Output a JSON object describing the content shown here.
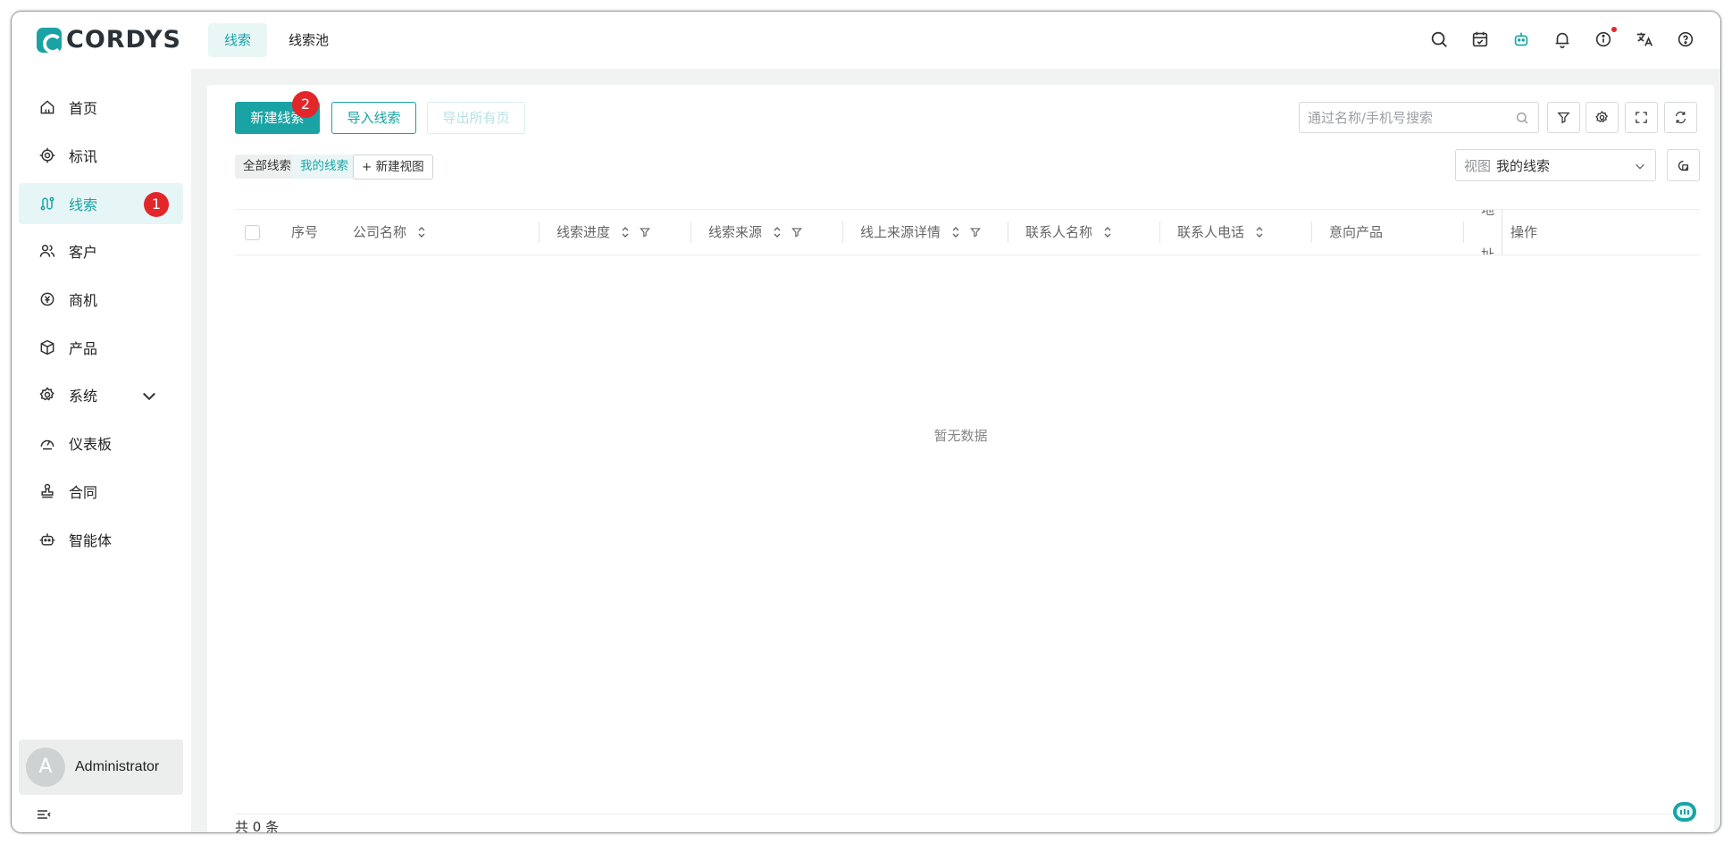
{
  "app": {
    "logo_text": "CORDYS"
  },
  "top_tabs": [
    {
      "label": "线索",
      "active": true
    },
    {
      "label": "线索池",
      "active": false
    }
  ],
  "top_icons": [
    "search-icon",
    "calendar-icon",
    "robot-icon",
    "bell-icon",
    "info-icon",
    "translate-icon",
    "help-icon"
  ],
  "sidebar": {
    "items": [
      {
        "label": "首页",
        "icon": "home-icon"
      },
      {
        "label": "标讯",
        "icon": "target-icon"
      },
      {
        "label": "线索",
        "icon": "route-icon",
        "active": true,
        "badge": "1"
      },
      {
        "label": "客户",
        "icon": "users-icon"
      },
      {
        "label": "商机",
        "icon": "yen-icon"
      },
      {
        "label": "产品",
        "icon": "box-icon"
      },
      {
        "label": "系统",
        "icon": "gear-icon",
        "expandable": true
      },
      {
        "label": "仪表板",
        "icon": "dashboard-icon"
      },
      {
        "label": "合同",
        "icon": "stamp-icon"
      },
      {
        "label": "智能体",
        "icon": "robot-icon"
      }
    ],
    "user": {
      "avatar_letter": "A",
      "name": "Administrator"
    }
  },
  "toolbar": {
    "new_label": "新建线索",
    "new_badge": "2",
    "import_label": "导入线索",
    "export_label": "导出所有页",
    "search_placeholder": "通过名称/手机号搜索"
  },
  "views": {
    "all": "全部线索",
    "mine": "我的线索",
    "new_view": "+ 新建视图",
    "select_label": "视图",
    "select_value": "我的线索"
  },
  "table": {
    "columns": [
      "序号",
      "公司名称",
      "线索进度",
      "线索来源",
      "线上来源详情",
      "联系人名称",
      "联系人电话",
      "意向产品",
      "地址",
      "操作"
    ],
    "empty_text": "暂无数据",
    "total": "共 0 条"
  },
  "colors": {
    "accent": "#1aa3a5",
    "badge": "#e3262a"
  }
}
